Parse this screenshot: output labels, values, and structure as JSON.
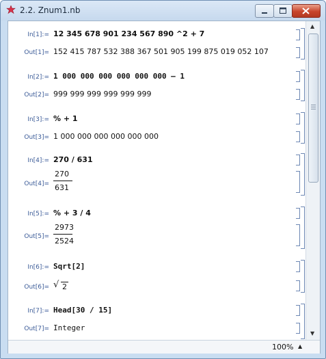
{
  "window": {
    "title": "2.2. Znum1.nb"
  },
  "cells": [
    {
      "in_label": "In[1]:=",
      "input": "12 345 678 901 234 567 890 ^2 + 7",
      "out_label": "Out[1]=",
      "output": "152 415 787 532 388 367 501 905 199 875 019 052 107"
    },
    {
      "in_label": "In[2]:=",
      "input": "1 000 000 000 000 000 000 – 1",
      "out_label": "Out[2]=",
      "output": "999 999 999 999 999 999"
    },
    {
      "in_label": "In[3]:=",
      "input": "% + 1",
      "out_label": "Out[3]=",
      "output": "1 000 000 000 000 000 000"
    },
    {
      "in_label": "In[4]:=",
      "input": "270 / 631",
      "out_label": "Out[4]=",
      "numerator": "270",
      "denominator": "631"
    },
    {
      "in_label": "In[5]:=",
      "input": "% + 3 / 4",
      "out_label": "Out[5]=",
      "numerator": "2973",
      "denominator": "2524"
    },
    {
      "in_label": "In[6]:=",
      "input": "Sqrt[2]",
      "out_label": "Out[6]=",
      "output": "2",
      "output_symbol": "√"
    },
    {
      "in_label": "In[7]:=",
      "input": "Head[30 / 15]",
      "out_label": "Out[7]=",
      "output": "Integer"
    }
  ],
  "status": {
    "zoom": "100%"
  },
  "icons": {
    "app": "mathematica-star-icon",
    "minimize": "minimize-icon",
    "maximize": "maximize-icon",
    "close": "close-icon"
  },
  "colors": {
    "label": "#3a5a97",
    "bracket": "#6b86b3",
    "close_button": "#c8452c"
  }
}
